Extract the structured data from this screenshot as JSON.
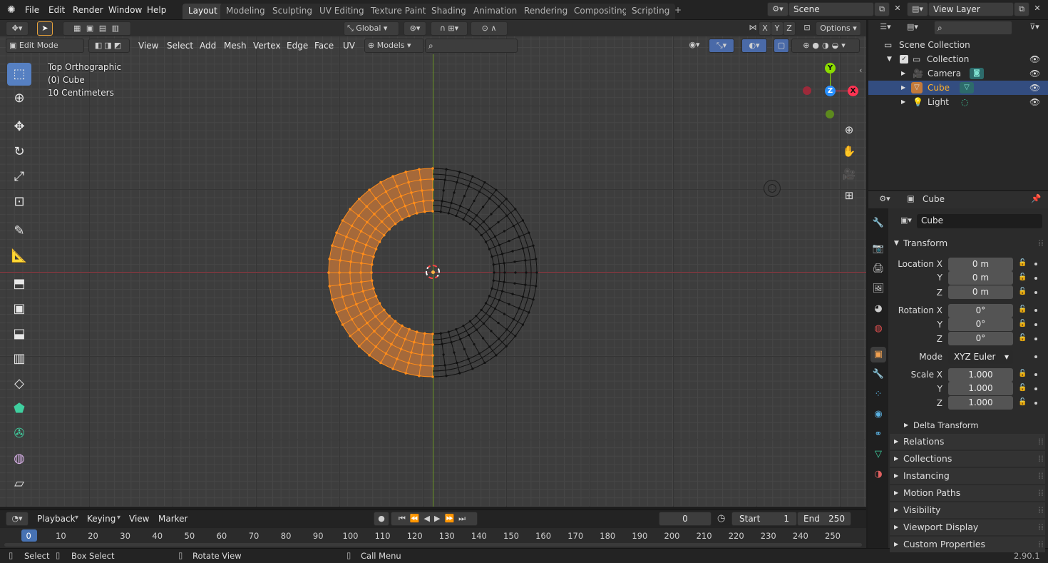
{
  "topbar": {
    "menus": [
      "File",
      "Edit",
      "Render",
      "Window",
      "Help"
    ],
    "workspaces": [
      "Layout",
      "Modeling",
      "Sculpting",
      "UV Editing",
      "Texture Paint",
      "Shading",
      "Animation",
      "Rendering",
      "Compositing",
      "Scripting"
    ],
    "add_tab": "+",
    "scene_label": "Scene",
    "view_layer_label": "View Layer"
  },
  "viewport_header": {
    "transform_orientation": "Global",
    "options_label": "Options",
    "axes": [
      "X",
      "Y",
      "Z"
    ],
    "mode": "Edit Mode",
    "menus": [
      "View",
      "Select",
      "Add",
      "Mesh",
      "Vertex",
      "Edge",
      "Face",
      "UV"
    ],
    "uv_selector": "Models"
  },
  "overlay": {
    "view_name": "Top Orthographic",
    "object_info": "(0) Cube",
    "scale_info": "10 Centimeters"
  },
  "gizmo": {
    "y": "Y",
    "z": "Z",
    "x": "X"
  },
  "timeline": {
    "menus": [
      "Playback",
      "Keying",
      "View",
      "Marker"
    ],
    "current_frame": "0",
    "start_label": "Start",
    "start_value": "1",
    "end_label": "End",
    "end_value": "250",
    "ticks": [
      "0",
      "10",
      "20",
      "30",
      "40",
      "50",
      "60",
      "70",
      "80",
      "90",
      "100",
      "110",
      "120",
      "130",
      "140",
      "150",
      "160",
      "170",
      "180",
      "190",
      "200",
      "210",
      "220",
      "230",
      "240",
      "250"
    ]
  },
  "statusbar": {
    "select": "Select",
    "box_select": "Box Select",
    "rotate_view": "Rotate View",
    "call_menu": "Call Menu",
    "version": "2.90.1"
  },
  "outliner": {
    "root": "Scene Collection",
    "collection": "Collection",
    "items": [
      {
        "label": "Camera",
        "selected": false
      },
      {
        "label": "Cube",
        "selected": true
      },
      {
        "label": "Light",
        "selected": false
      }
    ]
  },
  "properties": {
    "object_name_header": "Cube",
    "object_name_field": "Cube",
    "transform_title": "Transform",
    "location_label": "Location X",
    "rotation_label": "Rotation X",
    "scale_label": "Scale X",
    "y_label": "Y",
    "z_label": "Z",
    "location": [
      "0 m",
      "0 m",
      "0 m"
    ],
    "rotation": [
      "0°",
      "0°",
      "0°"
    ],
    "mode_label": "Mode",
    "mode_value": "XYZ Euler",
    "scale": [
      "1.000",
      "1.000",
      "1.000"
    ],
    "delta_transform": "Delta Transform",
    "panels": [
      "Relations",
      "Collections",
      "Instancing",
      "Motion Paths",
      "Visibility",
      "Viewport Display",
      "Custom Properties"
    ]
  },
  "colors": {
    "accent_blue": "#5680c2",
    "selection_orange": "#ff8c1a",
    "axis_x": "#ff3352",
    "axis_y": "#8bdc00",
    "axis_z": "#2890ff"
  }
}
